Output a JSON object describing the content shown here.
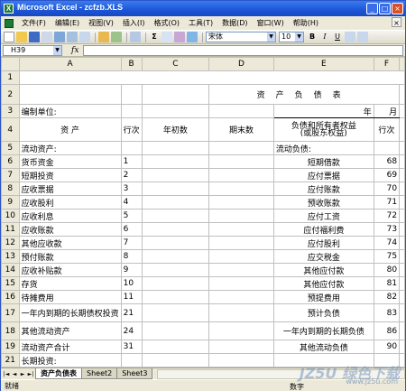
{
  "window": {
    "title": "Microsoft Excel - zcfzb.XLS",
    "app_icon": "X",
    "buttons": {
      "minimize": "_",
      "maximize": "□",
      "close": "×"
    }
  },
  "menu": [
    "文件(F)",
    "编辑(E)",
    "视图(V)",
    "插入(I)",
    "格式(O)",
    "工具(T)",
    "数据(D)",
    "窗口(W)",
    "帮助(H)"
  ],
  "toolbar": {
    "sum_icon": "Σ",
    "font_name": "宋体",
    "font_size": "10",
    "bold": "B",
    "italic": "I",
    "underline": "U"
  },
  "formula_bar": {
    "name_box": "H39",
    "fx": "fx",
    "formula": ""
  },
  "columns": [
    "A",
    "B",
    "C",
    "D",
    "E",
    "F"
  ],
  "rows": [
    "1",
    "2",
    "3",
    "4",
    "5",
    "6",
    "7",
    "8",
    "9",
    "10",
    "11",
    "12",
    "13",
    "14",
    "15",
    "16",
    "17",
    "18",
    "19",
    "20",
    "21"
  ],
  "sheet": {
    "title": "资产负债表",
    "org_label": "编制单位:",
    "year_label": "年",
    "month_label": "月",
    "headers": {
      "asset": "资 产",
      "line_no": "行次",
      "begin": "年初数",
      "end": "期末数",
      "liab": "负债和所有者权益",
      "liab_sub": "(或股东权益)",
      "line_no2": "行次"
    },
    "section_assets": "流动资产:",
    "section_liab": "流动负债:",
    "items": [
      {
        "asset": "货币资金",
        "no": "1",
        "liab": "短期借款",
        "no2": "68"
      },
      {
        "asset": "短期投资",
        "no": "2",
        "liab": "应付票据",
        "no2": "69"
      },
      {
        "asset": "应收票据",
        "no": "3",
        "liab": "应付账款",
        "no2": "70"
      },
      {
        "asset": "应收股利",
        "no": "4",
        "liab": "预收账款",
        "no2": "71"
      },
      {
        "asset": "应收利息",
        "no": "5",
        "liab": "应付工资",
        "no2": "72"
      },
      {
        "asset": "应收账款",
        "no": "6",
        "liab": "应付福利费",
        "no2": "73"
      },
      {
        "asset": "其他应收款",
        "no": "7",
        "liab": "应付股利",
        "no2": "74"
      },
      {
        "asset": "预付账款",
        "no": "8",
        "liab": "应交税金",
        "no2": "75"
      },
      {
        "asset": "应收补贴款",
        "no": "9",
        "liab": "其他应付款",
        "no2": "80"
      },
      {
        "asset": "存货",
        "no": "10",
        "liab": "其他应付款",
        "no2": "81"
      },
      {
        "asset": "待摊费用",
        "no": "11",
        "liab": "预提费用",
        "no2": "82"
      },
      {
        "asset": "一年内到期的长期债权投资",
        "no": "21",
        "liab": "预计负债",
        "no2": "83"
      },
      {
        "asset": "其他流动资产",
        "no": "24",
        "liab": "一年内到期的长期负债",
        "no2": "86"
      },
      {
        "asset": "流动资产合计",
        "no": "31",
        "liab": "其他流动负债",
        "no2": "90"
      }
    ],
    "row21": "长期投资:"
  },
  "tabs": [
    "资产负债表",
    "Sheet2",
    "Sheet3"
  ],
  "tab_nav": [
    "|◄",
    "◄",
    "►",
    "►|"
  ],
  "status": {
    "left": "就绪",
    "right": "数字"
  },
  "watermark": {
    "text": "JZ5U 绿色下载",
    "url": "www.jz5u.com"
  }
}
